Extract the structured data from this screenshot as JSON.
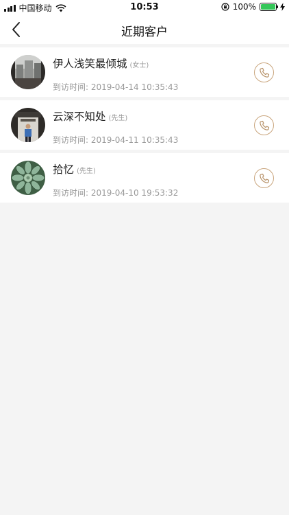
{
  "status_bar": {
    "carrier": "中国移动",
    "time": "10:53",
    "battery": "100%"
  },
  "nav": {
    "title": "近期客户"
  },
  "customers": [
    {
      "name": "伊人浅笑最倾城",
      "gender": "(女士)",
      "visit_label": "到访时间:",
      "visit_time": "2019-04-14 10:35:43"
    },
    {
      "name": "云深不知处",
      "gender": "(先生)",
      "visit_label": "到访时间:",
      "visit_time": "2019-04-11 10:35:43"
    },
    {
      "name": "拾忆",
      "gender": "(先生)",
      "visit_label": "到访时间:",
      "visit_time": "2019-04-10 19:53:32"
    }
  ],
  "colors": {
    "accent": "#c9a57d",
    "background": "#f4f4f4",
    "battery": "#34c759"
  }
}
